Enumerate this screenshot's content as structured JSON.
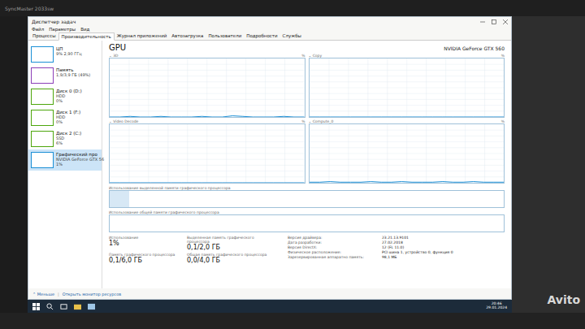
{
  "monitor": {
    "label": "SyncMaster 2033sw"
  },
  "window": {
    "title": "Диспетчер задач"
  },
  "menu": [
    "Файл",
    "Параметры",
    "Вид"
  ],
  "tabs": [
    {
      "label": "Процессы",
      "selected": false
    },
    {
      "label": "Производительность",
      "selected": true
    },
    {
      "label": "Журнал приложений",
      "selected": false
    },
    {
      "label": "Автозагрузка",
      "selected": false
    },
    {
      "label": "Пользователи",
      "selected": false
    },
    {
      "label": "Подробности",
      "selected": false
    },
    {
      "label": "Службы",
      "selected": false
    }
  ],
  "sidebar": {
    "items": [
      {
        "name": "ЦП",
        "detail": "9% 2,90 ГГц",
        "value": "",
        "selected": false,
        "color": "#1b8fd6"
      },
      {
        "name": "Память",
        "detail": "1,9/3,9 ГБ (49%)",
        "value": "",
        "selected": false,
        "color": "#8b3fb8"
      },
      {
        "name": "Диск 0 (D:)",
        "detail": "HDD",
        "value": "0%",
        "selected": false,
        "color": "#4da60c"
      },
      {
        "name": "Диск 1 (F:)",
        "detail": "HDD",
        "value": "0%",
        "selected": false,
        "color": "#4da60c"
      },
      {
        "name": "Диск 2 (C:)",
        "detail": "SSD",
        "value": "6%",
        "selected": false,
        "color": "#4da60c"
      },
      {
        "name": "Графический про",
        "detail": "NVIDIA GeForce GTX 56",
        "value": "1%",
        "selected": true,
        "color": "#1b8fd6"
      }
    ]
  },
  "gpu": {
    "title": "GPU",
    "model": "NVIDIA GeForce GTX 560",
    "graphs": [
      {
        "label": "3D",
        "unit": "%",
        "values": [
          0,
          0,
          1,
          0,
          0,
          1,
          0,
          0,
          0,
          1,
          0,
          0,
          2,
          1,
          0,
          0,
          0,
          1,
          0,
          0
        ]
      },
      {
        "label": "Copy",
        "unit": "%",
        "values": [
          0,
          0,
          0,
          0,
          0,
          0,
          0,
          0,
          0,
          0,
          0,
          0,
          0,
          0,
          0,
          0,
          0,
          0,
          0,
          0
        ]
      },
      {
        "label": "Video Decode",
        "unit": "%",
        "values": [
          0,
          0,
          0,
          0,
          0,
          0,
          0,
          0,
          0,
          0,
          0,
          0,
          0,
          0,
          0,
          0,
          0,
          0,
          0,
          0
        ]
      },
      {
        "label": "Compute_0",
        "unit": "%",
        "values": [
          1,
          1,
          2,
          1,
          1,
          1,
          2,
          1,
          1,
          2,
          1,
          1,
          1,
          2,
          1,
          1,
          2,
          1,
          1,
          1
        ]
      }
    ],
    "memory_bars": [
      {
        "label": "Использование выделенной памяти графического процессора",
        "level": 0.05
      },
      {
        "label": "Использование общей памяти графического процессора",
        "level": 0.0
      }
    ],
    "stats": [
      {
        "label": "Использование",
        "value": "1%"
      },
      {
        "label": "Выделенная память графического процессора",
        "value": "0,1/2,0 ГБ"
      },
      {
        "label": "Память графического процессора",
        "value": "0,1/6,0 ГБ"
      },
      {
        "label": "Общая память графического процессора",
        "value": "0,0/4,0 ГБ"
      }
    ],
    "details": [
      {
        "label": "Версия драйвера:",
        "value": "23.21.13.9101"
      },
      {
        "label": "Дата разработки:",
        "value": "27.02.2018"
      },
      {
        "label": "Версия DirectX:",
        "value": "12 (FL 11.0)"
      },
      {
        "label": "Физическое расположение:",
        "value": "PCI шина 1, устройство 0, функция 0"
      },
      {
        "label": "Зарезервированная аппаратно память:",
        "value": "98,1 МБ"
      }
    ]
  },
  "footer": {
    "less": "Меньше",
    "monitor": "Открыть монитор ресурсов"
  },
  "taskbar": {
    "time": "20:46",
    "date": "29.01.2024"
  },
  "watermark": "Avito"
}
